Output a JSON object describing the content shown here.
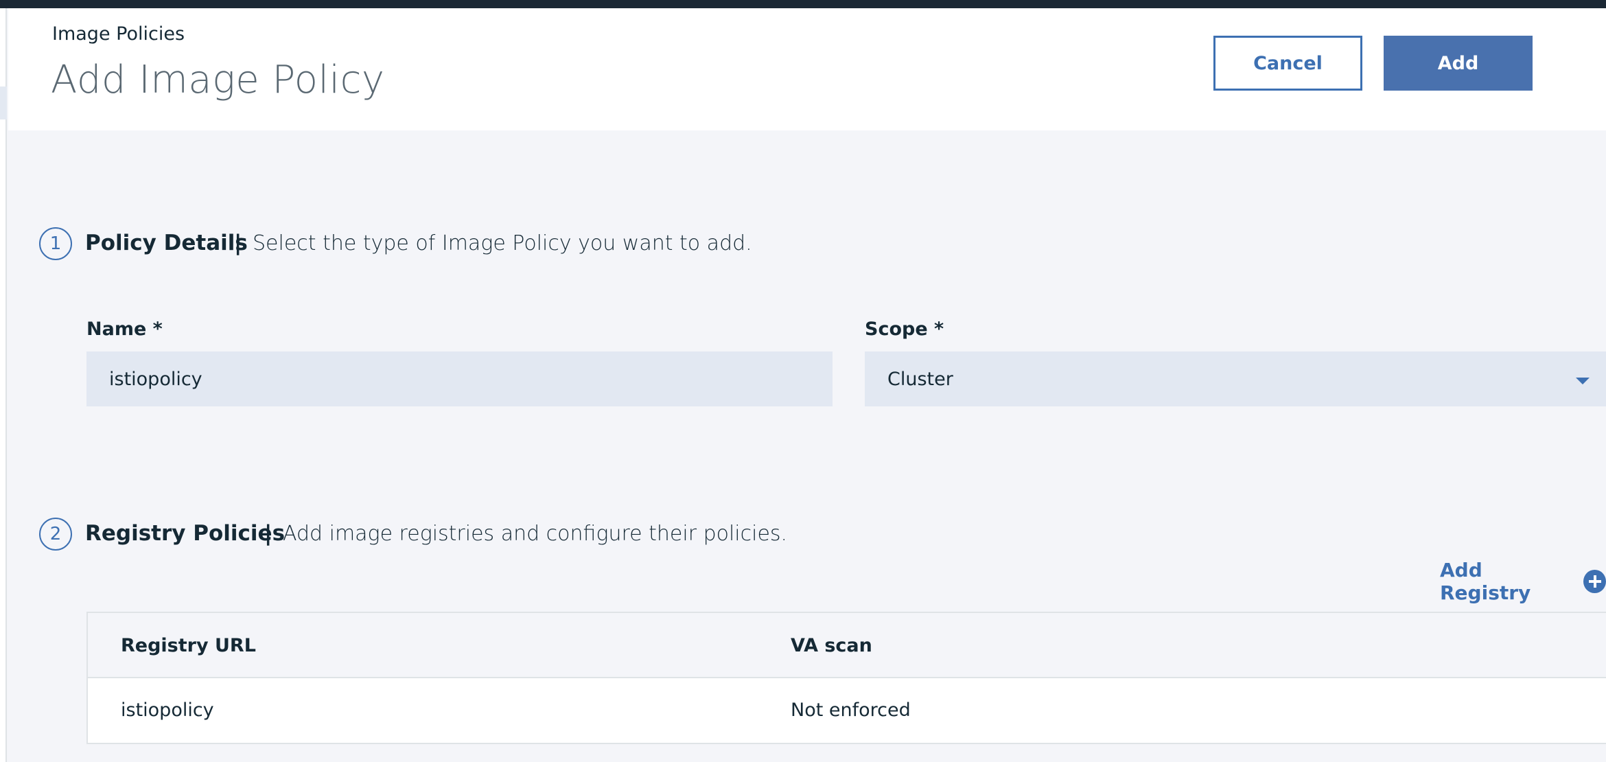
{
  "header": {
    "breadcrumb": "Image Policies",
    "title": "Add Image Policy",
    "cancel_label": "Cancel",
    "add_label": "Add"
  },
  "steps": [
    {
      "number": "1",
      "title": "Policy Details",
      "separator": "|",
      "description": "Select the type of Image Policy you want to add."
    },
    {
      "number": "2",
      "title": "Registry Policies",
      "separator": "|",
      "description": "Add image registries and configure their policies."
    }
  ],
  "form": {
    "name_label": "Name *",
    "name_value": "istiopolicy",
    "scope_label": "Scope *",
    "scope_value": "Cluster"
  },
  "registry": {
    "add_label": "Add Registry",
    "columns": [
      "Registry URL",
      "VA scan"
    ],
    "rows": [
      [
        "istiopolicy",
        "Not enforced"
      ]
    ]
  },
  "icons": {
    "scope_dropdown": "chevron-down-icon",
    "add_registry": "plus-circle-icon"
  },
  "colors": {
    "accent": "#3d70b2",
    "primary_button": "#4971ae",
    "field_background": "#e2e8f2",
    "page_background": "#f4f5f9",
    "topbar": "#1b2834"
  }
}
